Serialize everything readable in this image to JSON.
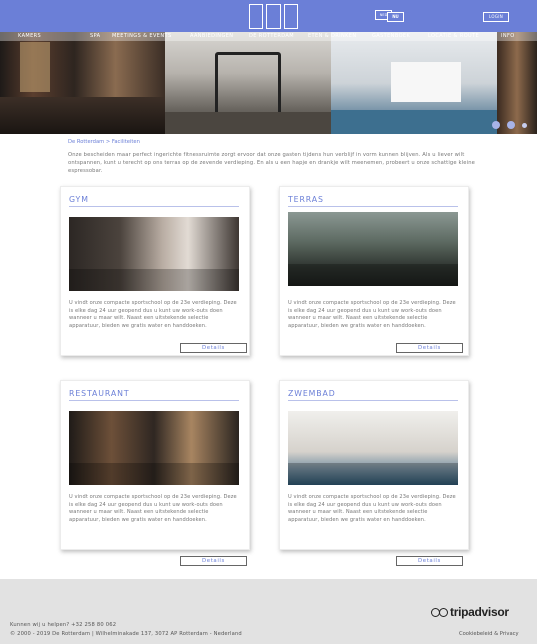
{
  "header": {
    "lang_back": "NED",
    "lang_front": "NU",
    "login_label": "LOGIN"
  },
  "nav": {
    "items": [
      "KAMERS",
      "SPA",
      "MEETINGS & EVENTS",
      "AANBIEDINGEN",
      "DE ROTTERDAM",
      "ETEN & DRINKEN",
      "GASTENBOEK",
      "LOCATIE & ROUTE",
      "INFO"
    ]
  },
  "breadcrumb": "De Rotterdam > Faciliteiten",
  "intro": "Onze bescheiden maar perfect ingerichte fitnessruimte zorgt ervoor dat onze gasten tijdens hun verblijf in vorm kunnen blijven. Als u liever wilt ontspannen, kunt u terecht op ons terras op de zevende verdieping. En als u een hapje en drankje wilt meenemen, probeert u onze schattige kleine espressobar.",
  "cards": [
    {
      "title": "GYM",
      "text": "U vindt onze compacte sportschool op de 23e verdieping. Deze is elke dag 24 uur geopend dus u kunt uw work-outs doen wanneer u maar wilt. Naast een uitstekende selectie apparatuur, bieden we gratis water en handdoeken.",
      "button": "Details"
    },
    {
      "title": "TERRAS",
      "text": "U vindt onze compacte sportschool op de 23e verdieping. Deze is elke dag 24 uur geopend dus u kunt uw work-outs doen wanneer u maar wilt. Naast een uitstekende selectie apparatuur, bieden we gratis water en handdoeken.",
      "button": "Details"
    },
    {
      "title": "RESTAURANT",
      "text": "U vindt onze compacte sportschool op de 23e verdieping. Deze is elke dag 24 uur geopend dus u kunt uw work-outs doen wanneer u maar wilt. Naast een uitstekende selectie apparatuur, bieden we gratis water en handdoeken.",
      "button": "Details"
    },
    {
      "title": "ZWEMBAD",
      "text": "U vindt onze compacte sportschool op de 23e verdieping. Deze is elke dag 24 uur geopend dus u kunt uw work-outs doen wanneer u maar wilt. Naast een uitstekende selectie apparatuur, bieden we gratis water en handdoeken.",
      "button": "Details"
    }
  ],
  "footer": {
    "help": "Kunnen wij u helpen?  +32 258 80 062",
    "copyright": "© 2000 - 2019 De Rotterdam | Wilhelminakade 137, 3072 AP Rotterdam - Nederland",
    "legal": "Cookiebeleid & Privacy",
    "tripadvisor": "tripadvisor"
  },
  "colors": {
    "accent": "#6b7fd7",
    "footer_bg": "#e2e2e2"
  },
  "icons": [
    "hotel-logo-icon",
    "language-switch-icon",
    "tripadvisor-owl-icon"
  ]
}
